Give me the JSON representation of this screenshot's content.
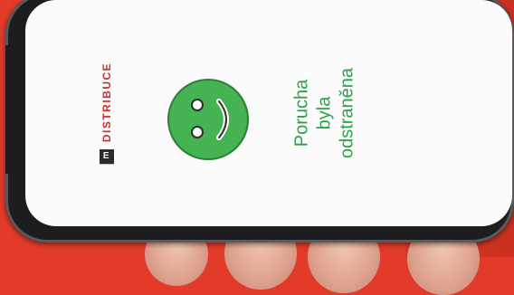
{
  "brand": {
    "logo_letter": "E",
    "name": "DISTRIBUCE"
  },
  "status_message": {
    "lines": [
      "Porucha",
      "byla",
      "odstraněna"
    ]
  },
  "icons": {
    "smiley": "smiley-face-icon"
  },
  "colors": {
    "background": "#e23b2a",
    "brand_red": "#c8302a",
    "message_green": "#2ca14a",
    "smiley_fill": "#45b352",
    "phone_frame": "#1d1d1f"
  }
}
